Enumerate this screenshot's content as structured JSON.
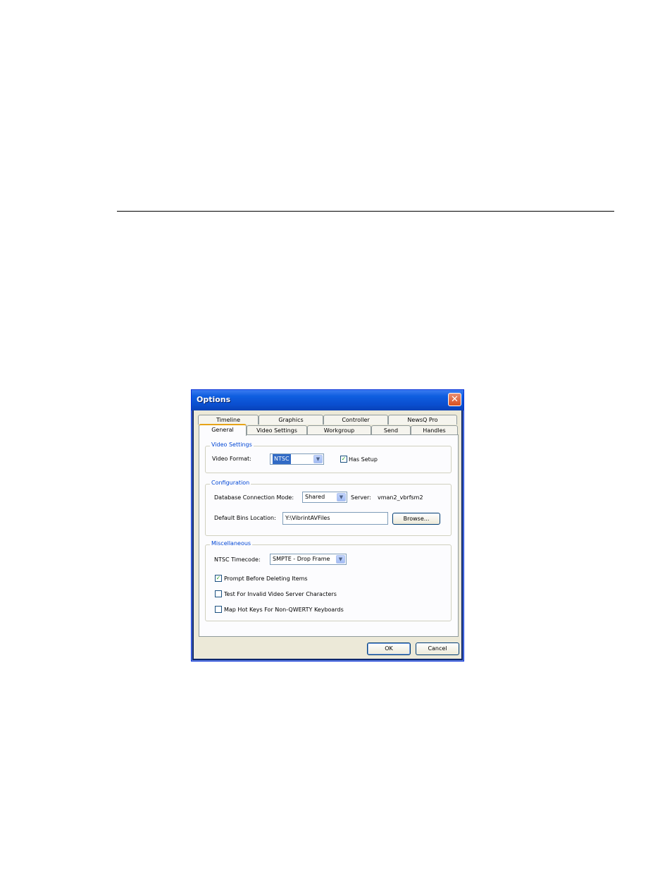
{
  "window": {
    "title": "Options",
    "close_glyph": "✕"
  },
  "tabs": {
    "row1": [
      "Timeline",
      "Graphics",
      "Controller",
      "NewsQ Pro"
    ],
    "row2": [
      "General",
      "Video Settings",
      "Workgroup",
      "Send",
      "Handles"
    ],
    "active": "General"
  },
  "video_settings": {
    "legend": "Video Settings",
    "format_label": "Video Format:",
    "format_value": "NTSC",
    "has_setup_label": "Has Setup",
    "has_setup_checked": true
  },
  "configuration": {
    "legend": "Configuration",
    "db_mode_label": "Database Connection Mode:",
    "db_mode_value": "Shared",
    "server_label": "Server:",
    "server_value": "vman2_vbrfsm2",
    "bins_label": "Default Bins Location:",
    "bins_value": "Y:\\VibrintAVFiles",
    "browse_label": "Browse..."
  },
  "miscellaneous": {
    "legend": "Miscellaneous",
    "timecode_label": "NTSC Timecode:",
    "timecode_value": "SMPTE - Drop Frame",
    "options": [
      {
        "label": "Prompt Before Deleting Items",
        "checked": true
      },
      {
        "label": "Test For Invalid Video Server Characters",
        "checked": false
      },
      {
        "label": "Map Hot Keys For Non-QWERTY Keyboards",
        "checked": false
      }
    ]
  },
  "footer": {
    "ok_label": "OK",
    "cancel_label": "Cancel"
  },
  "icons": {
    "check": "check-icon",
    "dropdown": "chevron-down-icon",
    "close": "close-icon"
  },
  "colors": {
    "titlebar": "#0a4fd0",
    "legend": "#0046d5",
    "check": "#21a121",
    "selection": "#316ac5"
  }
}
